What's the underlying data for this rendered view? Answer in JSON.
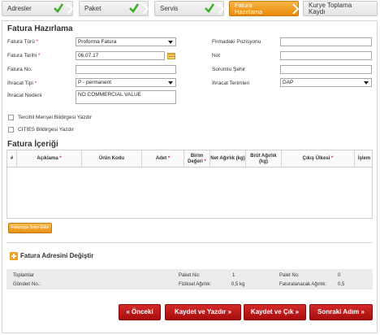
{
  "steps": [
    {
      "label": "Adresler",
      "done": true
    },
    {
      "label": "Paket",
      "done": true
    },
    {
      "label": "Servis",
      "done": true
    },
    {
      "label_line1": "Fatura",
      "label_line2": "Hazırlama",
      "active": true
    },
    {
      "label_line1": "Kurye Toplama",
      "label_line2": "Kaydı"
    }
  ],
  "section_title": "Fatura Hazırlama",
  "form": {
    "fatura_turu": {
      "label": "Fatura Türü",
      "required": "*",
      "value": "Proforma Fatura"
    },
    "fatura_tarihi": {
      "label": "Fatura Tarihi",
      "required": "*",
      "value": "06.07.17"
    },
    "fatura_no": {
      "label": "Fatura No.",
      "value": ""
    },
    "ihracat_tipi": {
      "label": "İhracat Tipi",
      "required": "*",
      "value": "P - permanent"
    },
    "ihracat_nedeni": {
      "label": "İhracat Nedeni",
      "value": "NO COMMERCIAL VALUE"
    },
    "firmadaki_pozisyonu": {
      "label": "Firmadaki Pozisyonu",
      "value": ""
    },
    "not": {
      "label": "Not",
      "value": ""
    },
    "sorumlu_sehir": {
      "label": "Sorumlu Şehir",
      "value": ""
    },
    "ihracat_terimleri": {
      "label": "İhracat Terimleri",
      "value": "DAP"
    }
  },
  "checkboxes": {
    "mensei": "Tercihli Menşei Bildirgesi Yazdır",
    "cites": "CITIES Bildirgesi Yazdır"
  },
  "content_title": "Fatura İçeriği",
  "table_headers": [
    {
      "label": "#"
    },
    {
      "label": "Açıklama",
      "req": "*"
    },
    {
      "label": "Ürün Kodu"
    },
    {
      "label": "Adet",
      "req": "*"
    },
    {
      "label": "Birim Değeri",
      "req": "*"
    },
    {
      "label": "Net Ağırlık (kg)"
    },
    {
      "label": "Brüt Ağırlık (kg)"
    },
    {
      "label": "Çıkış Ülkesi",
      "req": "*"
    },
    {
      "label": "İşlem"
    }
  ],
  "add_row_button": "Faturaya Satır Ekle",
  "address_change": "Fatura Adresini Değiştir",
  "summary": {
    "toplamlar": "Toplamlar",
    "gonderi_no": "Gönderi No.:",
    "paket_no_label": "Paket No:",
    "paket_no_value": "1",
    "fiziksel_label": "Fiziksel Ağırlık:",
    "fiziksel_value": "0,5 kg",
    "palet_no_label": "Palet No:",
    "palet_no_value": "0",
    "faturalanacak_label": "Faturalanacak Ağırlık:",
    "faturalanacak_value": "0,5"
  },
  "buttons": {
    "onceki": "« Önceki",
    "kaydet_yazdir": "Kaydet ve Yazdır »",
    "kaydet_cik": "Kaydet ve Çık »",
    "sonraki": "Sonraki Adım »"
  },
  "colors": {
    "accent_orange": "#e98a0a",
    "button_red": "#b51414",
    "required_red": "#e02020",
    "check_green": "#3fae2a"
  }
}
